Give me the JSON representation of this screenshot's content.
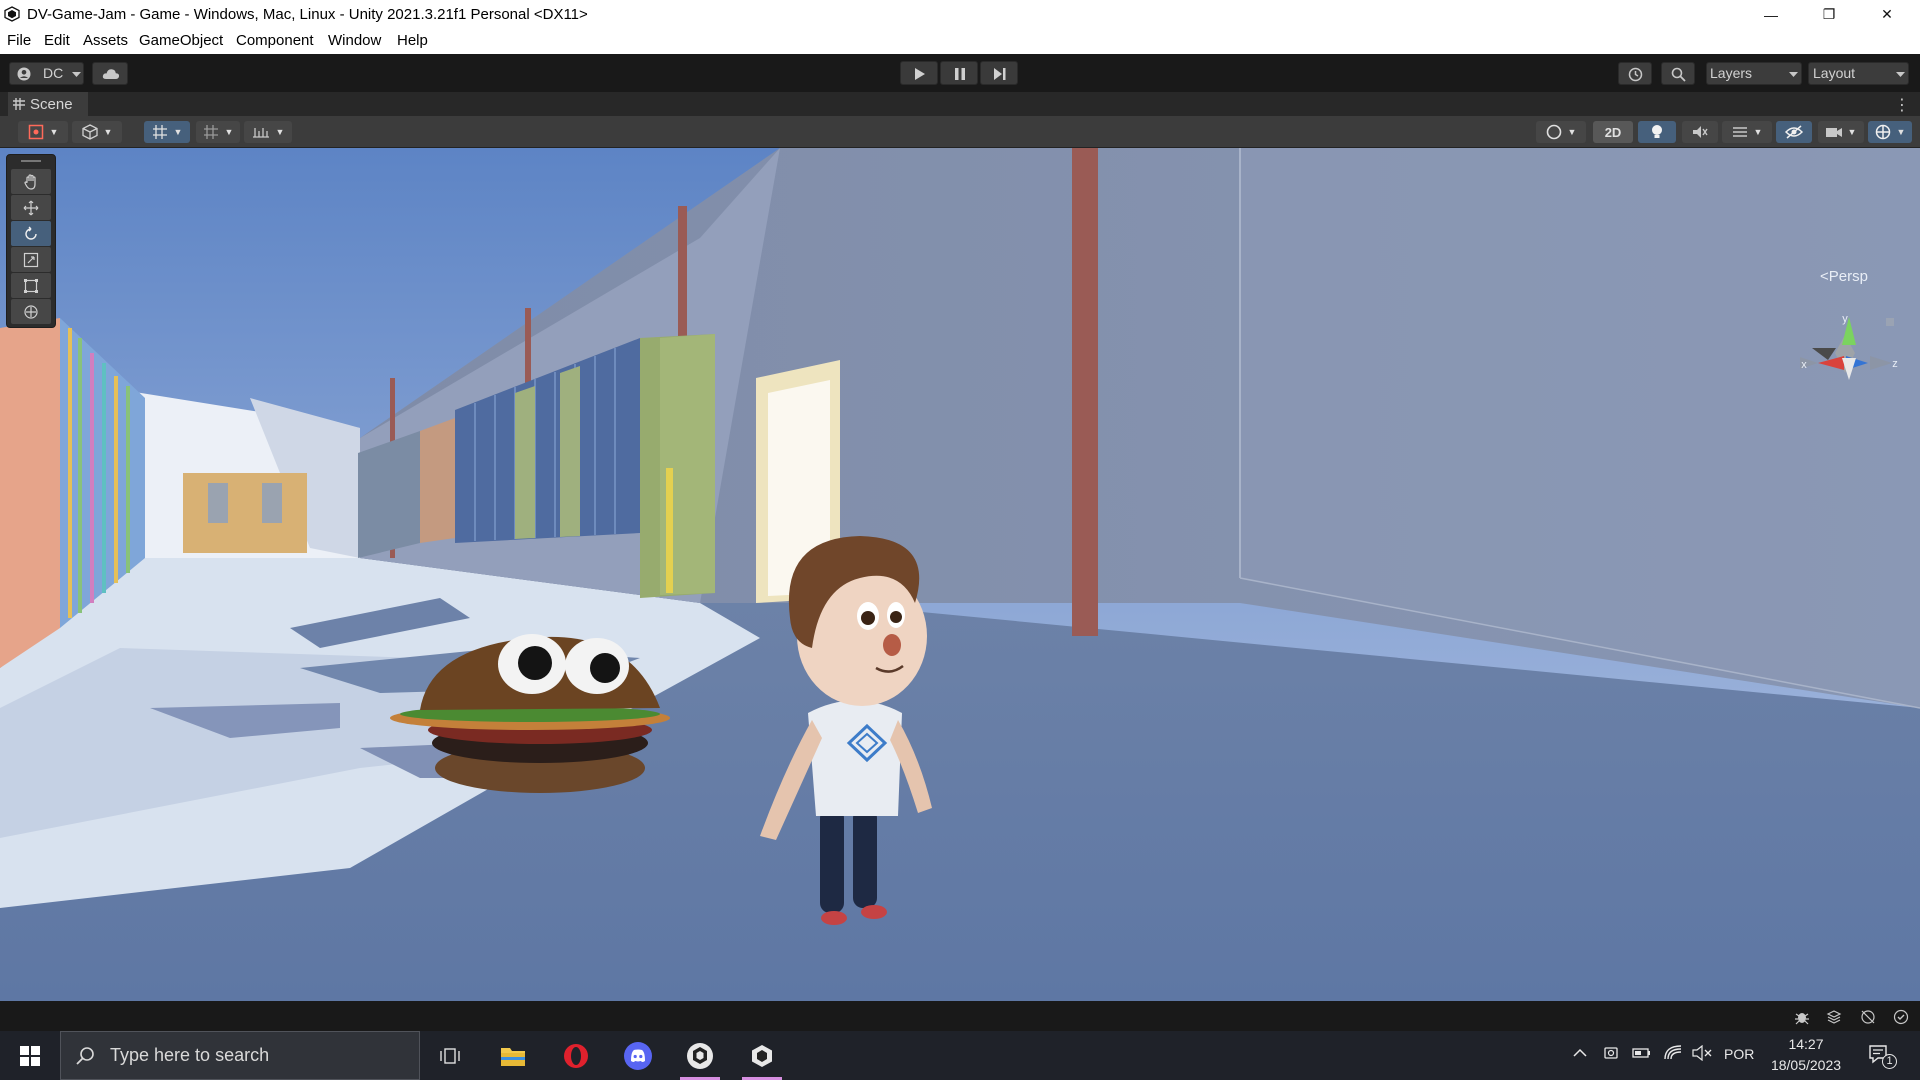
{
  "window": {
    "title": "DV-Game-Jam - Game - Windows, Mac, Linux - Unity 2021.3.21f1 Personal <DX11>",
    "minimize": "—",
    "maximize": "❐",
    "close": "✕"
  },
  "menu": [
    "File",
    "Edit",
    "Assets",
    "GameObject",
    "Component",
    "Window",
    "Help"
  ],
  "toolbar": {
    "account": "DC",
    "layers": "Layers",
    "layout": "Layout"
  },
  "scene_tab": {
    "label": "Scene"
  },
  "scene_view": {
    "toggle_2d": "2D",
    "projection": "Persp",
    "axis_x": "x",
    "axis_y": "y",
    "axis_z": "z"
  },
  "taskbar": {
    "search_placeholder": "Type here to search",
    "language": "POR",
    "time": "14:27",
    "date": "18/05/2023",
    "notification_count": "1"
  },
  "colors": {
    "accent_active": "#46607c",
    "task_underline": "#d68fe0"
  }
}
